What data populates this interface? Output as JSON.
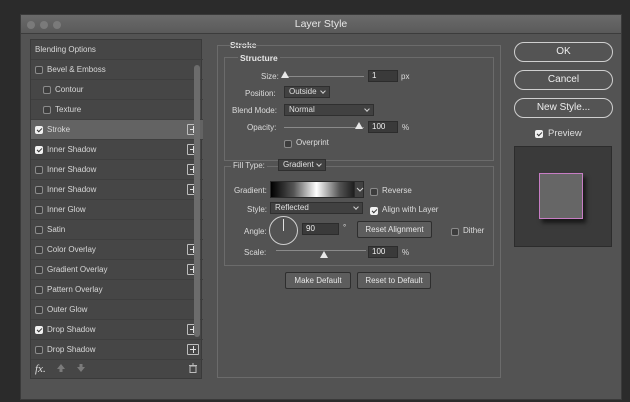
{
  "window": {
    "title": "Layer Style"
  },
  "left_panel": {
    "items": [
      {
        "label": "Blending Options",
        "checkbox": null,
        "plus": false,
        "indent": false,
        "selected": false
      },
      {
        "label": "Bevel & Emboss",
        "checkbox": false,
        "plus": false,
        "indent": false,
        "selected": false
      },
      {
        "label": "Contour",
        "checkbox": false,
        "plus": false,
        "indent": true,
        "selected": false
      },
      {
        "label": "Texture",
        "checkbox": false,
        "plus": false,
        "indent": true,
        "selected": false
      },
      {
        "label": "Stroke",
        "checkbox": true,
        "plus": true,
        "indent": false,
        "selected": true
      },
      {
        "label": "Inner Shadow",
        "checkbox": true,
        "plus": true,
        "indent": false,
        "selected": false
      },
      {
        "label": "Inner Shadow",
        "checkbox": false,
        "plus": true,
        "indent": false,
        "selected": false
      },
      {
        "label": "Inner Shadow",
        "checkbox": false,
        "plus": true,
        "indent": false,
        "selected": false
      },
      {
        "label": "Inner Glow",
        "checkbox": false,
        "plus": false,
        "indent": false,
        "selected": false
      },
      {
        "label": "Satin",
        "checkbox": false,
        "plus": false,
        "indent": false,
        "selected": false
      },
      {
        "label": "Color Overlay",
        "checkbox": false,
        "plus": true,
        "indent": false,
        "selected": false
      },
      {
        "label": "Gradient Overlay",
        "checkbox": false,
        "plus": true,
        "indent": false,
        "selected": false
      },
      {
        "label": "Pattern Overlay",
        "checkbox": false,
        "plus": false,
        "indent": false,
        "selected": false
      },
      {
        "label": "Outer Glow",
        "checkbox": false,
        "plus": false,
        "indent": false,
        "selected": false
      },
      {
        "label": "Drop Shadow",
        "checkbox": true,
        "plus": true,
        "indent": false,
        "selected": false
      },
      {
        "label": "Drop Shadow",
        "checkbox": false,
        "plus": true,
        "indent": false,
        "selected": false
      }
    ],
    "footer": {
      "fx_label": "fx.",
      "up_icon": "arrow-up-icon",
      "down_icon": "arrow-down-icon",
      "trash_icon": "trash-icon"
    }
  },
  "stroke": {
    "section_title": "Stroke",
    "structure_title": "Structure",
    "size_label": "Size:",
    "size_value": "1",
    "size_unit": "px",
    "position_label": "Position:",
    "position_value": "Outside",
    "blend_label": "Blend Mode:",
    "blend_value": "Normal",
    "opacity_label": "Opacity:",
    "opacity_value": "100",
    "opacity_unit": "%",
    "overprint_label": "Overprint",
    "overprint_checked": false,
    "fill_type_label": "Fill Type:",
    "fill_type_value": "Gradient",
    "gradient_label": "Gradient:",
    "reverse_label": "Reverse",
    "reverse_checked": false,
    "style_label": "Style:",
    "style_value": "Reflected",
    "align_label": "Align with Layer",
    "align_checked": true,
    "angle_label": "Angle:",
    "angle_value": "90",
    "angle_unit": "°",
    "reset_alignment": "Reset Alignment",
    "dither_label": "Dither",
    "dither_checked": false,
    "scale_label": "Scale:",
    "scale_value": "100",
    "scale_unit": "%",
    "make_default": "Make Default",
    "reset_default": "Reset to Default"
  },
  "buttons": {
    "ok": "OK",
    "cancel": "Cancel",
    "new_style": "New Style..."
  },
  "preview": {
    "label": "Preview",
    "checked": true
  },
  "colors": {
    "dialog_bg": "#535353",
    "stroke_preview": "#c77dc4"
  }
}
